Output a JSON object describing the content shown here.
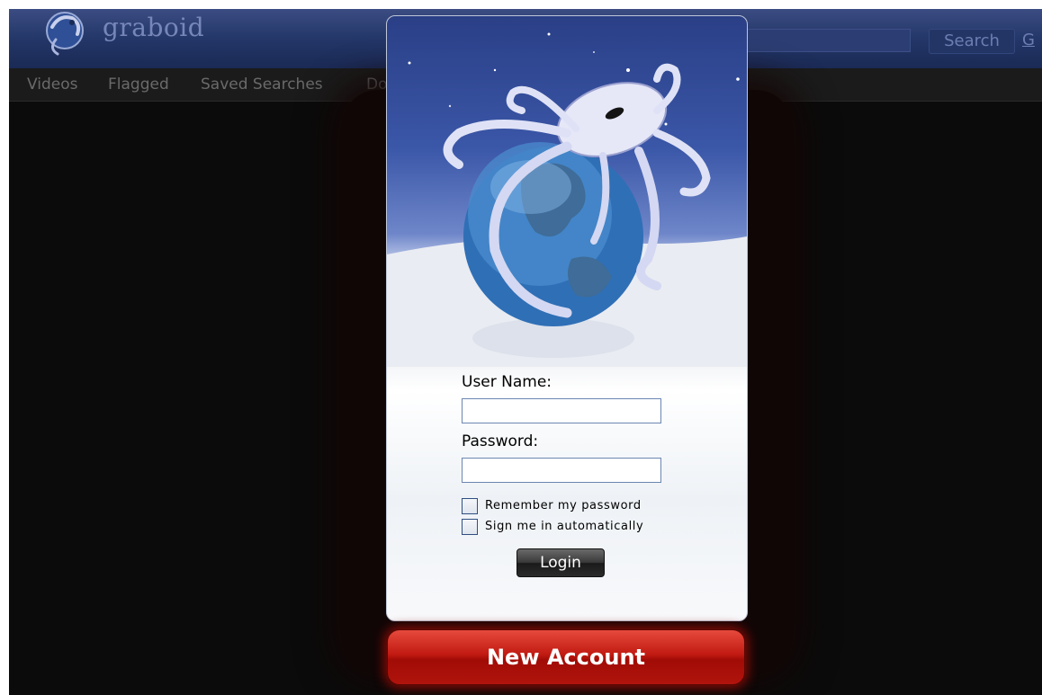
{
  "header": {
    "logo_text": "graboid",
    "search_button_label": "Search",
    "cutoff_link_text": "G"
  },
  "nav": {
    "items": [
      "Videos",
      "Flagged",
      "Saved Searches",
      "Do"
    ]
  },
  "login_dialog": {
    "username_label": "User Name:",
    "username_value": "",
    "password_label": "Password:",
    "password_value": "",
    "remember_password_label": "Remember my password",
    "sign_in_auto_label": "Sign me in automatically",
    "login_button_label": "Login"
  },
  "new_account_button_label": "New Account",
  "colors": {
    "header_bg": "#223566",
    "nav_bg": "#1b1b1b",
    "page_bg": "#0b0b0b",
    "new_account_red": "#c11a12",
    "login_button_dark": "#2b2b2b"
  },
  "icons": {
    "logo": "graboid-octopus-globe-logo",
    "illustration": "octopus-on-globe-illustration"
  }
}
